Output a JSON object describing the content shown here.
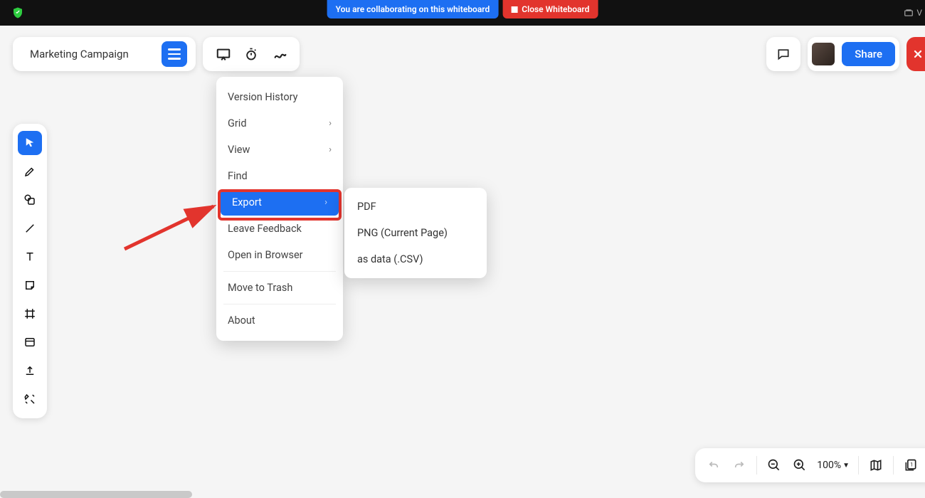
{
  "topbar": {
    "collab_text": "You are collaborating on this whiteboard",
    "close_text": "Close Whiteboard",
    "right_label": "V"
  },
  "header": {
    "title": "Marketing Campaign",
    "share_label": "Share"
  },
  "menu": {
    "version_history": "Version History",
    "grid": "Grid",
    "view": "View",
    "find": "Find",
    "export": "Export",
    "leave_feedback": "Leave Feedback",
    "open_in_browser": "Open in Browser",
    "move_to_trash": "Move to Trash",
    "about": "About"
  },
  "export_submenu": {
    "pdf": "PDF",
    "png": "PNG (Current Page)",
    "csv": "as data (.CSV)"
  },
  "bottombar": {
    "zoom": "100%"
  },
  "colors": {
    "primary": "#1d6ff2",
    "danger": "#e2342d"
  }
}
